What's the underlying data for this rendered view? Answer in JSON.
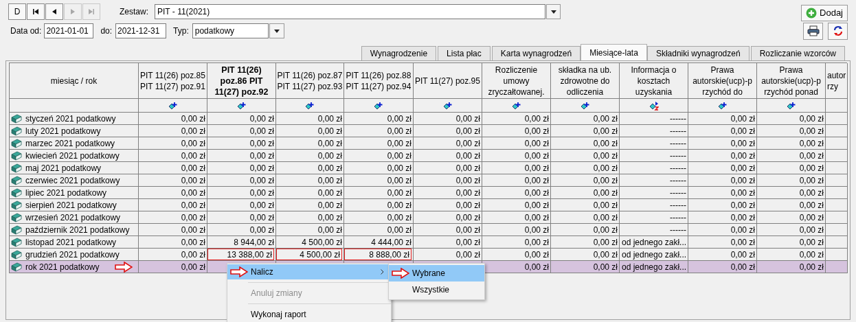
{
  "nav_buttons": [
    {
      "kind": "text",
      "label": "D",
      "disabled": false
    },
    {
      "kind": "first",
      "disabled": false
    },
    {
      "kind": "prev",
      "disabled": false
    },
    {
      "kind": "next",
      "disabled": true
    },
    {
      "kind": "last",
      "disabled": true
    }
  ],
  "set_field": {
    "label": "Zestaw:",
    "value": "PIT - 11(2021)"
  },
  "date_from": {
    "label": "Data od:",
    "value": "2021-01-01"
  },
  "date_to": {
    "label": "do:",
    "value": "2021-12-31"
  },
  "type_field": {
    "label": "Typ:",
    "value": "podatkowy"
  },
  "add_button": {
    "label": "Dodaj"
  },
  "tabs": [
    {
      "label": "Wynagrodzenie",
      "selected": false
    },
    {
      "label": "Lista płac",
      "selected": false
    },
    {
      "label": "Karta wynagrodzeń",
      "selected": false
    },
    {
      "label": "Miesiące-lata",
      "selected": true
    },
    {
      "label": "Składniki wynagrodzeń",
      "selected": false
    },
    {
      "label": "Rozliczanie wzorców",
      "selected": false
    }
  ],
  "table": {
    "label_column": {
      "lines": [
        "miesiąc / rok"
      ]
    },
    "columns": [
      {
        "lines": [
          "PIT 11(26) poz.85",
          "PIT 11(27) poz.91"
        ],
        "bold": false,
        "kind": "plus"
      },
      {
        "lines": [
          "PIT 11(26)",
          "poz.86 PIT",
          "11(27) poz.92"
        ],
        "bold": true,
        "kind": "plus"
      },
      {
        "lines": [
          "PIT 11(26) poz.87",
          "PIT 11(27) poz.93"
        ],
        "bold": false,
        "kind": "plus"
      },
      {
        "lines": [
          "PIT 11(26) poz.88",
          "PIT 11(27) poz.94"
        ],
        "bold": false,
        "kind": "plus"
      },
      {
        "lines": [
          "PIT 11(27) poz.95"
        ],
        "bold": false,
        "kind": "plus"
      },
      {
        "lines": [
          "Rozliczenie",
          "umowy",
          "zryczałtowanej."
        ],
        "bold": false,
        "kind": "plus"
      },
      {
        "lines": [
          "składka na ub.",
          "zdrowotne do",
          "odliczenia"
        ],
        "bold": false,
        "kind": "plus"
      },
      {
        "lines": [
          "Informacja o",
          "kosztach",
          "uzyskania"
        ],
        "bold": false,
        "kind": "sort"
      },
      {
        "lines": [
          "Prawa",
          "autorskie(ucp)-p",
          "rzychód do"
        ],
        "bold": false,
        "kind": "plus"
      },
      {
        "lines": [
          "Prawa",
          "autorskie(ucp)-p",
          "rzychód ponad"
        ],
        "bold": false,
        "kind": "plus"
      },
      {
        "lines": [
          "autor",
          "rzy"
        ],
        "bold": false
      }
    ],
    "rows": [
      {
        "label": "styczeń 2021 podatkowy",
        "selected": false,
        "arrow": false,
        "cells": [
          {
            "text": "0,00 zł",
            "modified": false
          },
          {
            "text": "0,00 zł",
            "modified": false
          },
          {
            "text": "0,00 zł",
            "modified": false
          },
          {
            "text": "0,00 zł",
            "modified": false
          },
          {
            "text": "0,00 zł",
            "modified": false
          },
          {
            "text": "0,00 zł",
            "modified": false
          },
          {
            "text": "0,00 zł",
            "modified": false
          },
          {
            "text": "------",
            "modified": false
          },
          {
            "text": "0,00 zł",
            "modified": false
          },
          {
            "text": "0,00 zł",
            "modified": false
          }
        ]
      },
      {
        "label": "luty 2021 podatkowy",
        "selected": false,
        "arrow": false,
        "cells": [
          {
            "text": "0,00 zł",
            "modified": false
          },
          {
            "text": "0,00 zł",
            "modified": false
          },
          {
            "text": "0,00 zł",
            "modified": false
          },
          {
            "text": "0,00 zł",
            "modified": false
          },
          {
            "text": "0,00 zł",
            "modified": false
          },
          {
            "text": "0,00 zł",
            "modified": false
          },
          {
            "text": "0,00 zł",
            "modified": false
          },
          {
            "text": "------",
            "modified": false
          },
          {
            "text": "0,00 zł",
            "modified": false
          },
          {
            "text": "0,00 zł",
            "modified": false
          }
        ]
      },
      {
        "label": "marzec 2021 podatkowy",
        "selected": false,
        "arrow": false,
        "cells": [
          {
            "text": "0,00 zł",
            "modified": false
          },
          {
            "text": "0,00 zł",
            "modified": false
          },
          {
            "text": "0,00 zł",
            "modified": false
          },
          {
            "text": "0,00 zł",
            "modified": false
          },
          {
            "text": "0,00 zł",
            "modified": false
          },
          {
            "text": "0,00 zł",
            "modified": false
          },
          {
            "text": "0,00 zł",
            "modified": false
          },
          {
            "text": "------",
            "modified": false
          },
          {
            "text": "0,00 zł",
            "modified": false
          },
          {
            "text": "0,00 zł",
            "modified": false
          }
        ]
      },
      {
        "label": "kwiecień 2021 podatkowy",
        "selected": false,
        "arrow": false,
        "cells": [
          {
            "text": "0,00 zł",
            "modified": false
          },
          {
            "text": "0,00 zł",
            "modified": false
          },
          {
            "text": "0,00 zł",
            "modified": false
          },
          {
            "text": "0,00 zł",
            "modified": false
          },
          {
            "text": "0,00 zł",
            "modified": false
          },
          {
            "text": "0,00 zł",
            "modified": false
          },
          {
            "text": "0,00 zł",
            "modified": false
          },
          {
            "text": "------",
            "modified": false
          },
          {
            "text": "0,00 zł",
            "modified": false
          },
          {
            "text": "0,00 zł",
            "modified": false
          }
        ]
      },
      {
        "label": "maj 2021 podatkowy",
        "selected": false,
        "arrow": false,
        "cells": [
          {
            "text": "0,00 zł",
            "modified": false
          },
          {
            "text": "0,00 zł",
            "modified": false
          },
          {
            "text": "0,00 zł",
            "modified": false
          },
          {
            "text": "0,00 zł",
            "modified": false
          },
          {
            "text": "0,00 zł",
            "modified": false
          },
          {
            "text": "0,00 zł",
            "modified": false
          },
          {
            "text": "0,00 zł",
            "modified": false
          },
          {
            "text": "------",
            "modified": false
          },
          {
            "text": "0,00 zł",
            "modified": false
          },
          {
            "text": "0,00 zł",
            "modified": false
          }
        ]
      },
      {
        "label": "czerwiec 2021 podatkowy",
        "selected": false,
        "arrow": false,
        "cells": [
          {
            "text": "0,00 zł",
            "modified": false
          },
          {
            "text": "0,00 zł",
            "modified": false
          },
          {
            "text": "0,00 zł",
            "modified": false
          },
          {
            "text": "0,00 zł",
            "modified": false
          },
          {
            "text": "0,00 zł",
            "modified": false
          },
          {
            "text": "0,00 zł",
            "modified": false
          },
          {
            "text": "0,00 zł",
            "modified": false
          },
          {
            "text": "------",
            "modified": false
          },
          {
            "text": "0,00 zł",
            "modified": false
          },
          {
            "text": "0,00 zł",
            "modified": false
          }
        ]
      },
      {
        "label": "lipiec 2021 podatkowy",
        "selected": false,
        "arrow": false,
        "cells": [
          {
            "text": "0,00 zł",
            "modified": false
          },
          {
            "text": "0,00 zł",
            "modified": false
          },
          {
            "text": "0,00 zł",
            "modified": false
          },
          {
            "text": "0,00 zł",
            "modified": false
          },
          {
            "text": "0,00 zł",
            "modified": false
          },
          {
            "text": "0,00 zł",
            "modified": false
          },
          {
            "text": "0,00 zł",
            "modified": false
          },
          {
            "text": "------",
            "modified": false
          },
          {
            "text": "0,00 zł",
            "modified": false
          },
          {
            "text": "0,00 zł",
            "modified": false
          }
        ]
      },
      {
        "label": "sierpień 2021 podatkowy",
        "selected": false,
        "arrow": false,
        "cells": [
          {
            "text": "0,00 zł",
            "modified": false
          },
          {
            "text": "0,00 zł",
            "modified": false
          },
          {
            "text": "0,00 zł",
            "modified": false
          },
          {
            "text": "0,00 zł",
            "modified": false
          },
          {
            "text": "0,00 zł",
            "modified": false
          },
          {
            "text": "0,00 zł",
            "modified": false
          },
          {
            "text": "0,00 zł",
            "modified": false
          },
          {
            "text": "------",
            "modified": false
          },
          {
            "text": "0,00 zł",
            "modified": false
          },
          {
            "text": "0,00 zł",
            "modified": false
          }
        ]
      },
      {
        "label": "wrzesień 2021 podatkowy",
        "selected": false,
        "arrow": false,
        "cells": [
          {
            "text": "0,00 zł",
            "modified": false
          },
          {
            "text": "0,00 zł",
            "modified": false
          },
          {
            "text": "0,00 zł",
            "modified": false
          },
          {
            "text": "0,00 zł",
            "modified": false
          },
          {
            "text": "0,00 zł",
            "modified": false
          },
          {
            "text": "0,00 zł",
            "modified": false
          },
          {
            "text": "0,00 zł",
            "modified": false
          },
          {
            "text": "------",
            "modified": false
          },
          {
            "text": "0,00 zł",
            "modified": false
          },
          {
            "text": "0,00 zł",
            "modified": false
          }
        ]
      },
      {
        "label": "październik 2021 podatkowy",
        "selected": false,
        "arrow": false,
        "cells": [
          {
            "text": "0,00 zł",
            "modified": false
          },
          {
            "text": "0,00 zł",
            "modified": false
          },
          {
            "text": "0,00 zł",
            "modified": false
          },
          {
            "text": "0,00 zł",
            "modified": false
          },
          {
            "text": "0,00 zł",
            "modified": false
          },
          {
            "text": "0,00 zł",
            "modified": false
          },
          {
            "text": "0,00 zł",
            "modified": false
          },
          {
            "text": "------",
            "modified": false
          },
          {
            "text": "0,00 zł",
            "modified": false
          },
          {
            "text": "0,00 zł",
            "modified": false
          }
        ]
      },
      {
        "label": "listopad 2021 podatkowy",
        "selected": false,
        "arrow": false,
        "cells": [
          {
            "text": "0,00 zł",
            "modified": false
          },
          {
            "text": "8 944,00 zł",
            "modified": false
          },
          {
            "text": "4 500,00 zł",
            "modified": false
          },
          {
            "text": "4 444,00 zł",
            "modified": false
          },
          {
            "text": "0,00 zł",
            "modified": false
          },
          {
            "text": "0,00 zł",
            "modified": false
          },
          {
            "text": "0,00 zł",
            "modified": false
          },
          {
            "text": "od jednego zakł...",
            "modified": false
          },
          {
            "text": "0,00 zł",
            "modified": false
          },
          {
            "text": "0,00 zł",
            "modified": false
          }
        ]
      },
      {
        "label": "grudzień 2021 podatkowy",
        "selected": false,
        "arrow": false,
        "cells": [
          {
            "text": "0,00 zł",
            "modified": false
          },
          {
            "text": "13 388,00 zł",
            "modified": true
          },
          {
            "text": "4 500,00 zł",
            "modified": true
          },
          {
            "text": "8 888,00 zł",
            "modified": true
          },
          {
            "text": "0,00 zł",
            "modified": false
          },
          {
            "text": "0,00 zł",
            "modified": false
          },
          {
            "text": "0,00 zł",
            "modified": false
          },
          {
            "text": "od jednego zakł...",
            "modified": false
          },
          {
            "text": "0,00 zł",
            "modified": false
          },
          {
            "text": "0,00 zł",
            "modified": false
          }
        ]
      },
      {
        "label": "rok 2021 podatkowy",
        "selected": true,
        "arrow": true,
        "cells": [
          {
            "text": "0,00 zł",
            "modified": false
          },
          null,
          null,
          null,
          null,
          {
            "text": "0,00 zł",
            "modified": false
          },
          {
            "text": "0,00 zł",
            "modified": false
          },
          {
            "text": "od jednego zakł...",
            "modified": false
          },
          {
            "text": "0,00 zł",
            "modified": false
          },
          {
            "text": "0,00 zł",
            "modified": false
          }
        ]
      }
    ]
  },
  "context_menu": {
    "items": [
      {
        "kind": "item",
        "label": "Nalicz",
        "selected": true,
        "disabled": false,
        "submenu": true,
        "arrow": true
      },
      {
        "kind": "separator"
      },
      {
        "kind": "item",
        "label": "Anuluj zmiany",
        "selected": false,
        "disabled": true,
        "submenu": false,
        "arrow": false
      },
      {
        "kind": "separator"
      },
      {
        "kind": "item",
        "label": "Wykonaj raport",
        "selected": false,
        "disabled": false,
        "submenu": false,
        "arrow": false
      }
    ]
  },
  "submenu": {
    "items": [
      {
        "label": "Wybrane",
        "selected": true,
        "arrow": true
      },
      {
        "label": "Wszystkie",
        "selected": false,
        "arrow": false
      }
    ]
  }
}
